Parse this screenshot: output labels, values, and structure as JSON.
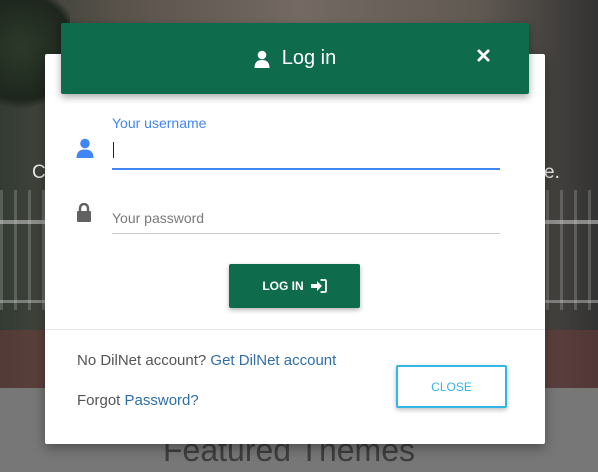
{
  "background": {
    "hero_text_left": "C",
    "hero_text_right": "e.",
    "featured_heading": "Featured Themes"
  },
  "modal": {
    "title": "Log in",
    "header_icon": "user-icon",
    "close_icon": "close-icon",
    "username": {
      "label": "Your username",
      "value": "",
      "icon": "user-icon"
    },
    "password": {
      "placeholder": "Your password",
      "value": "",
      "icon": "lock-icon"
    },
    "login_button": {
      "label": "LOG IN",
      "icon": "sign-in-icon"
    },
    "signup_prompt": "No DilNet account?",
    "signup_link": "Get DilNet account",
    "forgot_prompt": "Forgot",
    "forgot_link": "Password?",
    "close_button": "CLOSE"
  },
  "colors": {
    "header_green": "#0e6b4c",
    "accent_blue": "#4285f4",
    "link_blue": "#2f6fa6",
    "close_border": "#33b5e5"
  }
}
